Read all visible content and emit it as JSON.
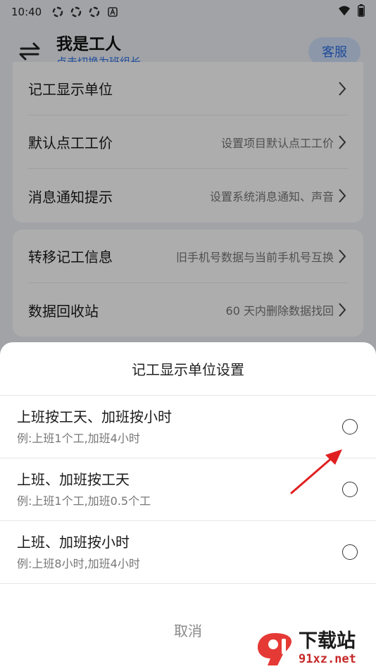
{
  "status_bar": {
    "time": "10:40",
    "icons": [
      "sync-icon",
      "sync-icon",
      "sync-icon",
      "a-icon"
    ],
    "right_icons": [
      "wifi-icon",
      "battery-icon"
    ]
  },
  "header": {
    "title": "我是工人",
    "subtitle": "点击切换为班组长",
    "service_label": "客服"
  },
  "settings_group_1": {
    "items": [
      {
        "label": "记工显示单位",
        "value": ""
      },
      {
        "label": "默认点工工价",
        "value": "设置项目默认点工工价"
      },
      {
        "label": "消息通知提示",
        "value": "设置系统消息通知、声音"
      }
    ]
  },
  "settings_group_2": {
    "items": [
      {
        "label": "转移记工信息",
        "value": "旧手机号数据与当前手机号互换"
      },
      {
        "label": "数据回收站",
        "value": "60 天内删除数据找回"
      }
    ]
  },
  "sheet": {
    "title": "记工显示单位设置",
    "options": [
      {
        "title": "上班按工天、加班按小时",
        "desc": "例:上班1个工,加班4小时"
      },
      {
        "title": "上班、加班按工天",
        "desc": "例:上班1个工,加班0.5个工"
      },
      {
        "title": "上班、加班按小时",
        "desc": "例:上班8小时,加班4小时"
      }
    ],
    "cancel_label": "取消"
  },
  "watermark": {
    "main": "下载站",
    "url": "91xz.net"
  },
  "colors": {
    "accent": "#2f6fe4",
    "annotation": "#e02020",
    "watermark_red": "#c62828"
  }
}
